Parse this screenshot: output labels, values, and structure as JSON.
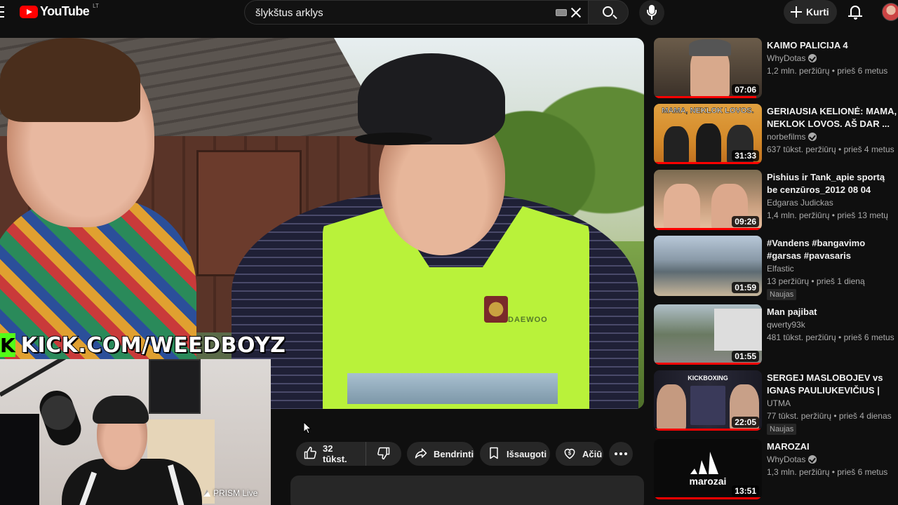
{
  "header": {
    "logo_text": "YouTube",
    "country_code": "LT",
    "search_value": "šlykštus arklys",
    "create_label": "Kurti"
  },
  "video": {
    "overlay_kick_text": "KICK.COM/WEEDBOYZ",
    "kick_logo_letter": "K",
    "vest_logo": "DAEWOO",
    "prism_label": "PRISM Live"
  },
  "actions": {
    "like_count": "32 tūkst.",
    "share_label": "Bendrinti",
    "save_label": "Išsaugoti",
    "thanks_label": "Ačiū"
  },
  "recommendations": [
    {
      "title": "KAIMO PALICIJA 4",
      "channel": "WhyDotas",
      "verified": true,
      "meta": "1,2 mln. peržiūrų • prieš 6 metus",
      "duration": "07:06",
      "progress": 0.95,
      "new": false
    },
    {
      "title": "GERIAUSIA KELIONĖ: MAMA, NEKLOK LOVOS. AŠ DAR ...",
      "channel": "norbefilms",
      "verified": true,
      "meta": "637 tūkst. peržiūrų • prieš 4 metus",
      "duration": "31:33",
      "progress": 1.0,
      "thumb_text": "MAMA, NEKLOK LOVOS.",
      "new": false
    },
    {
      "title": "Pishius ir Tank_apie sportą be cenzūros_2012 08 04",
      "channel": "Edgaras Judickas",
      "verified": false,
      "meta": "1,4 mln. peržiūrų • prieš 13 metų",
      "duration": "09:26",
      "progress": 1.0,
      "new": false
    },
    {
      "title": "#Vandens #bangavimo #garsas #pavasaris",
      "channel": "Elfastic",
      "verified": false,
      "meta": "13 peržiūrų • prieš 1 dieną",
      "duration": "01:59",
      "progress": 0,
      "new": true,
      "badge": "Naujas"
    },
    {
      "title": "Man pajibat",
      "channel": "qwerty93k",
      "verified": false,
      "meta": "481 tūkst. peržiūrų • prieš 6 metus",
      "duration": "01:55",
      "progress": 1.0,
      "new": false
    },
    {
      "title": "SERGEJ MASLOBOJEV vs IGNAS PAULIUKEVIČIUS | FUL...",
      "channel": "UTMA",
      "verified": false,
      "meta": "77 tūkst. peržiūrų • prieš 4 dienas",
      "duration": "22:05",
      "progress": 1.0,
      "new": true,
      "badge": "Naujas",
      "thumb_text": "KICKBOXING"
    },
    {
      "title": "MAROZAI",
      "channel": "WhyDotas",
      "verified": true,
      "meta": "1,3 mln. peržiūrų • prieš 6 metus",
      "duration": "13:51",
      "progress": 1.0,
      "new": false,
      "thumb_text": "marozai"
    }
  ],
  "colors": {
    "background": "#0f0f0f",
    "accent_red": "#ff0000",
    "kick_green": "#53fc18",
    "pill_bg": "#272727",
    "secondary_text": "#aaaaaa"
  }
}
